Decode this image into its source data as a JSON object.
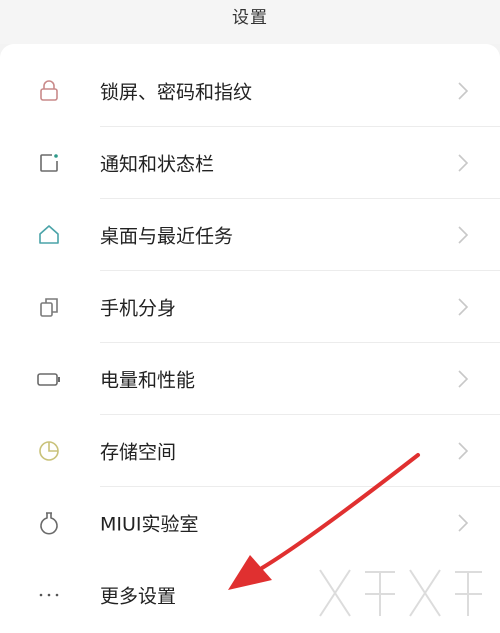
{
  "header": {
    "title": "设置"
  },
  "colors": {
    "lock": "#c98a8a",
    "notification": "#6a6a6a",
    "notification_dot": "#2f9a8a",
    "home": "#4aa3a8",
    "dual": "#7a7a7a",
    "battery": "#6a6a6a",
    "storage": "#c9c27a",
    "lab": "#6a6a6a",
    "more": "#555555",
    "chevron": "#c8c8c8",
    "annotation_arrow": "#e03030"
  },
  "settings": {
    "items": [
      {
        "label": "锁屏、密码和指纹",
        "icon": "lock-icon"
      },
      {
        "label": "通知和状态栏",
        "icon": "notification-icon"
      },
      {
        "label": "桌面与最近任务",
        "icon": "home-icon"
      },
      {
        "label": "手机分身",
        "icon": "dual-phone-icon"
      },
      {
        "label": "电量和性能",
        "icon": "battery-icon"
      },
      {
        "label": "存储空间",
        "icon": "storage-pie-icon"
      },
      {
        "label": "MIUI实验室",
        "icon": "flask-icon"
      },
      {
        "label": "更多设置",
        "icon": "more-dots-icon"
      }
    ]
  }
}
